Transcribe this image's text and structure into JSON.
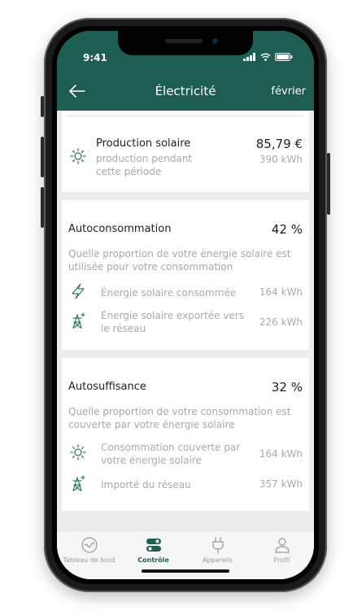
{
  "status": {
    "time": "9:41"
  },
  "nav": {
    "title": "Électricité",
    "month": "février"
  },
  "solar": {
    "title": "Production solaire",
    "subtitle": "production pendant\ncette période",
    "amount": "85,79 €",
    "energy": "390 kWh"
  },
  "autoconsommation": {
    "title": "Autoconsommation",
    "percent": "42 %",
    "description": "Quelle proportion de votre énergie solaire est utilisée pour votre consommation",
    "items": [
      {
        "label": "Énergie solaire consommée",
        "value": "164 kWh",
        "icon": "bolt-icon"
      },
      {
        "label": "Énergie solaire exportée vers le réseau",
        "value": "226 kWh",
        "icon": "pylon-export-icon"
      }
    ]
  },
  "autosuffisance": {
    "title": "Autosuffisance",
    "percent": "32 %",
    "description": "Quelle proportion de votre consommation est couverte par votre énergie solaire",
    "items": [
      {
        "label": "Consommation couverte par votre énergie solaire",
        "value": "164 kWh",
        "icon": "sun-icon"
      },
      {
        "label": "Importé du réseau",
        "value": "357 kWh",
        "icon": "pylon-import-icon"
      }
    ]
  },
  "tabbar": {
    "tabs": [
      {
        "label": "Tableau de bord",
        "icon": "gauge-icon",
        "active": false
      },
      {
        "label": "Contrôle",
        "icon": "toggle-icon",
        "active": true
      },
      {
        "label": "Appareils",
        "icon": "plug-icon",
        "active": false
      },
      {
        "label": "Profil",
        "icon": "person-icon",
        "active": false
      }
    ]
  },
  "colors": {
    "brand": "#1e5d52",
    "accent_icon": "#2f7a60",
    "background": "#ececec"
  }
}
